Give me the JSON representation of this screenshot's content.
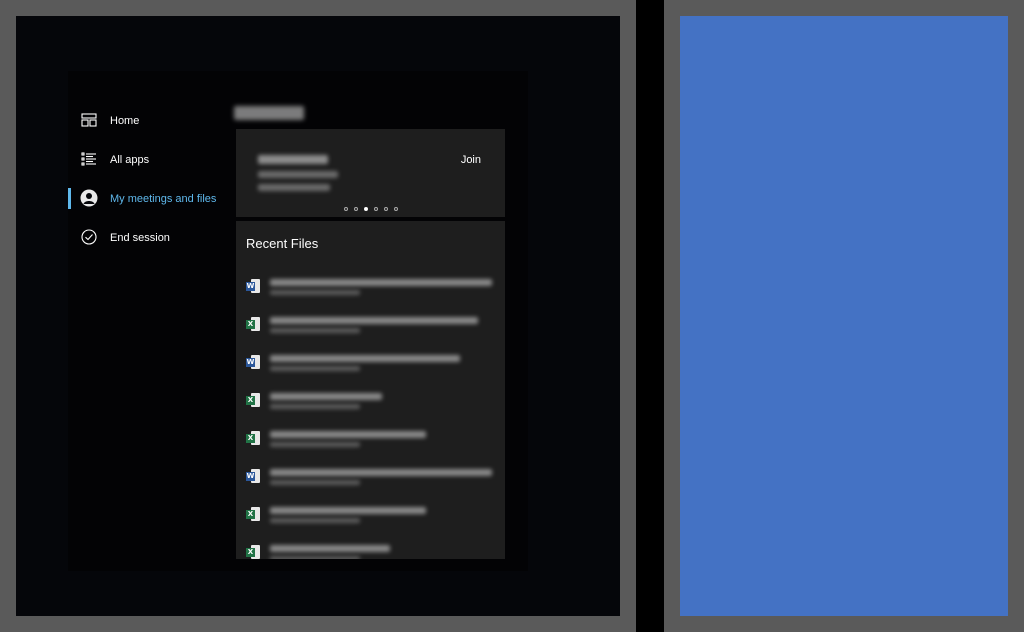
{
  "sidebar": {
    "items": [
      {
        "label": "Home",
        "icon": "dashboard-icon"
      },
      {
        "label": "All apps",
        "icon": "list-icon"
      },
      {
        "label": "My meetings and files",
        "icon": "person-icon",
        "active": true
      },
      {
        "label": "End session",
        "icon": "check-circle-icon"
      }
    ]
  },
  "meeting": {
    "join_label": "Join"
  },
  "files": {
    "title": "Recent Files",
    "items": [
      {
        "type": "word",
        "badge": "W"
      },
      {
        "type": "excel",
        "badge": "X"
      },
      {
        "type": "word",
        "badge": "W"
      },
      {
        "type": "excel",
        "badge": "X"
      },
      {
        "type": "excel",
        "badge": "X"
      },
      {
        "type": "word",
        "badge": "W"
      },
      {
        "type": "excel",
        "badge": "X"
      },
      {
        "type": "excel",
        "badge": "X"
      }
    ]
  },
  "colors": {
    "accent": "#5fb8ec",
    "card_bg": "#1e1e1e",
    "screen_bg": "#05060a",
    "second_screen": "#4472c4",
    "bezel": "#5a5a5a",
    "word": "#2b579a",
    "excel": "#217346"
  }
}
